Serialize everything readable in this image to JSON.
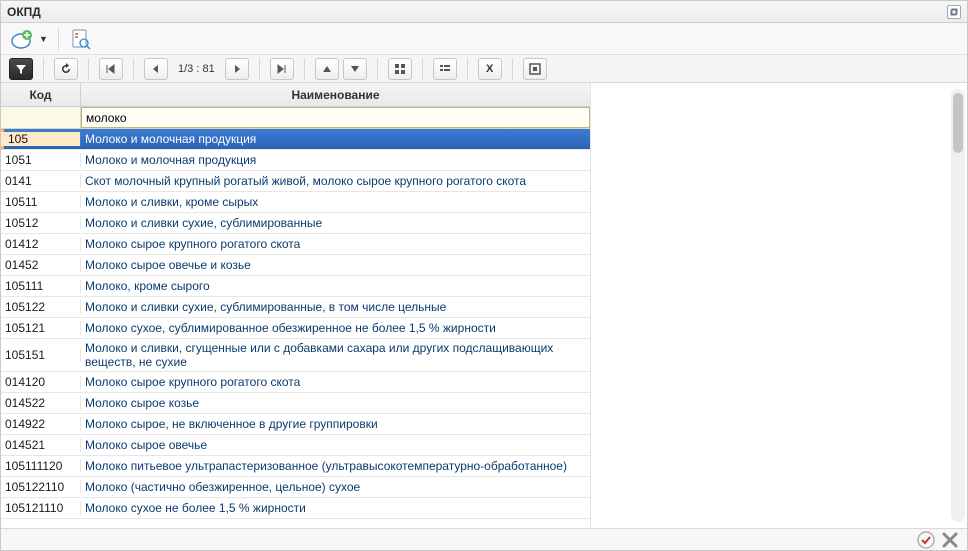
{
  "window": {
    "title": "ОКПД"
  },
  "toolbar2": {
    "pager_label": "1/3 : 81"
  },
  "grid": {
    "headers": {
      "code": "Код",
      "name": "Наименование"
    },
    "filter": {
      "code": "",
      "name_value": "молоко"
    },
    "selected_index": 0,
    "rows": [
      {
        "code": "105",
        "name": "Молоко и молочная продукция"
      },
      {
        "code": "1051",
        "name": "Молоко и молочная продукция"
      },
      {
        "code": "0141",
        "name": "Скот молочный крупный рогатый живой, молоко сырое крупного рогатого скота"
      },
      {
        "code": "10511",
        "name": "Молоко и сливки, кроме сырых"
      },
      {
        "code": "10512",
        "name": "Молоко и сливки сухие, сублимированные"
      },
      {
        "code": "01412",
        "name": "Молоко сырое крупного рогатого скота"
      },
      {
        "code": "01452",
        "name": "Молоко сырое овечье и козье"
      },
      {
        "code": "105111",
        "name": "Молоко, кроме сырого"
      },
      {
        "code": "105122",
        "name": "Молоко и сливки сухие, сублимированные, в том числе цельные"
      },
      {
        "code": "105121",
        "name": "Молоко сухое, сублимированное обезжиренное не более 1,5 % жирности"
      },
      {
        "code": "105151",
        "name": "Молоко и сливки, сгущенные или с добавками сахара или других подслащивающих веществ, не сухие"
      },
      {
        "code": "014120",
        "name": "Молоко сырое крупного рогатого скота"
      },
      {
        "code": "014522",
        "name": "Молоко сырое козье"
      },
      {
        "code": "014922",
        "name": "Молоко сырое, не включенное в другие группировки"
      },
      {
        "code": "014521",
        "name": "Молоко сырое овечье"
      },
      {
        "code": "105111120",
        "name": "Молоко питьевое ультрапастеризованное (ультравысокотемпературно-обработанное)"
      },
      {
        "code": "105122110",
        "name": "Молоко (частично обезжиренное, цельное) сухое"
      },
      {
        "code": "105121110",
        "name": "Молоко сухое не более 1,5 % жирности"
      }
    ]
  }
}
